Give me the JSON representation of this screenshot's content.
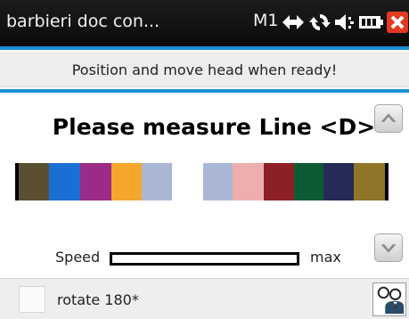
{
  "titlebar": {
    "title": "barbieri doc con...",
    "mode": "M1",
    "icons": [
      "bidirectional-arrow-icon",
      "sync-icon",
      "sound-icon",
      "battery-icon",
      "close-icon"
    ],
    "close_color": "#e23b22"
  },
  "banner": {
    "text": "Position and move head when ready!"
  },
  "main": {
    "title": "Please measure Line <D>",
    "scroll_up_icon": "chevron-up-icon",
    "scroll_down_icon": "chevron-down-icon",
    "color_bar": {
      "left_group": [
        "#5b4f33",
        "#1b6fd4",
        "#9a2b86",
        "#f5a62c",
        "#a9b7d5"
      ],
      "right_group": [
        "#a9b7d5",
        "#efaeae",
        "#8d2026",
        "#0d5b35",
        "#262a57",
        "#8f7527"
      ],
      "edge_color": "#000000"
    },
    "speed": {
      "label": "Speed",
      "max_label": "max",
      "level": 0
    }
  },
  "bottombar": {
    "rotate_label": "rotate 180*",
    "rotate_checked": false,
    "users_icon": "users-icon"
  },
  "colors": {
    "accent": "#1a8fd6",
    "titlebar": "#111111"
  }
}
